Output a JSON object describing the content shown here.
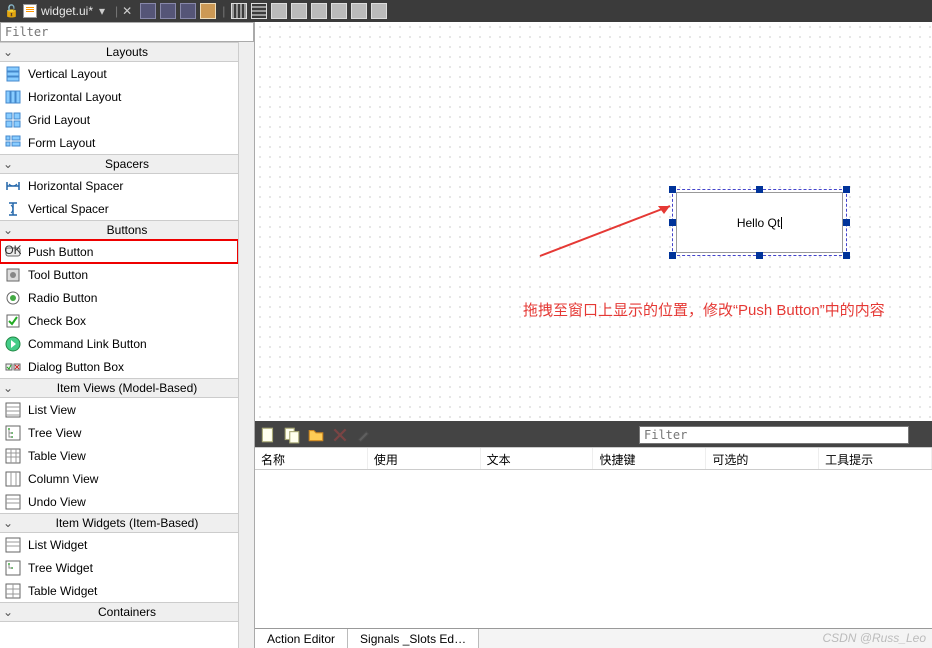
{
  "titlebar": {
    "filename": "widget.ui*"
  },
  "sidebar": {
    "filter_placeholder": "Filter",
    "categories": {
      "layouts": {
        "header": "Layouts",
        "items": [
          "Vertical Layout",
          "Horizontal Layout",
          "Grid Layout",
          "Form Layout"
        ]
      },
      "spacers": {
        "header": "Spacers",
        "items": [
          "Horizontal Spacer",
          "Vertical Spacer"
        ]
      },
      "buttons": {
        "header": "Buttons",
        "items": [
          "Push Button",
          "Tool Button",
          "Radio Button",
          "Check Box",
          "Command Link Button",
          "Dialog Button Box"
        ]
      },
      "item_views": {
        "header": "Item Views (Model-Based)",
        "items": [
          "List View",
          "Tree View",
          "Table View",
          "Column View",
          "Undo View"
        ]
      },
      "item_widgets": {
        "header": "Item Widgets (Item-Based)",
        "items": [
          "List Widget",
          "Tree Widget",
          "Table Widget"
        ]
      },
      "containers": {
        "header": "Containers"
      }
    }
  },
  "canvas": {
    "button_text": "Hello Qt",
    "annotation": "拖拽至窗口上显示的位置，修改“Push Button”中的内容"
  },
  "action_panel": {
    "filter_placeholder": "Filter",
    "columns": [
      "名称",
      "使用",
      "文本",
      "快捷键",
      "可选的",
      "工具提示"
    ]
  },
  "tabs": {
    "action_editor": "Action Editor",
    "signals_slots": "Signals _Slots Ed…"
  },
  "watermark": "CSDN @Russ_Leo"
}
